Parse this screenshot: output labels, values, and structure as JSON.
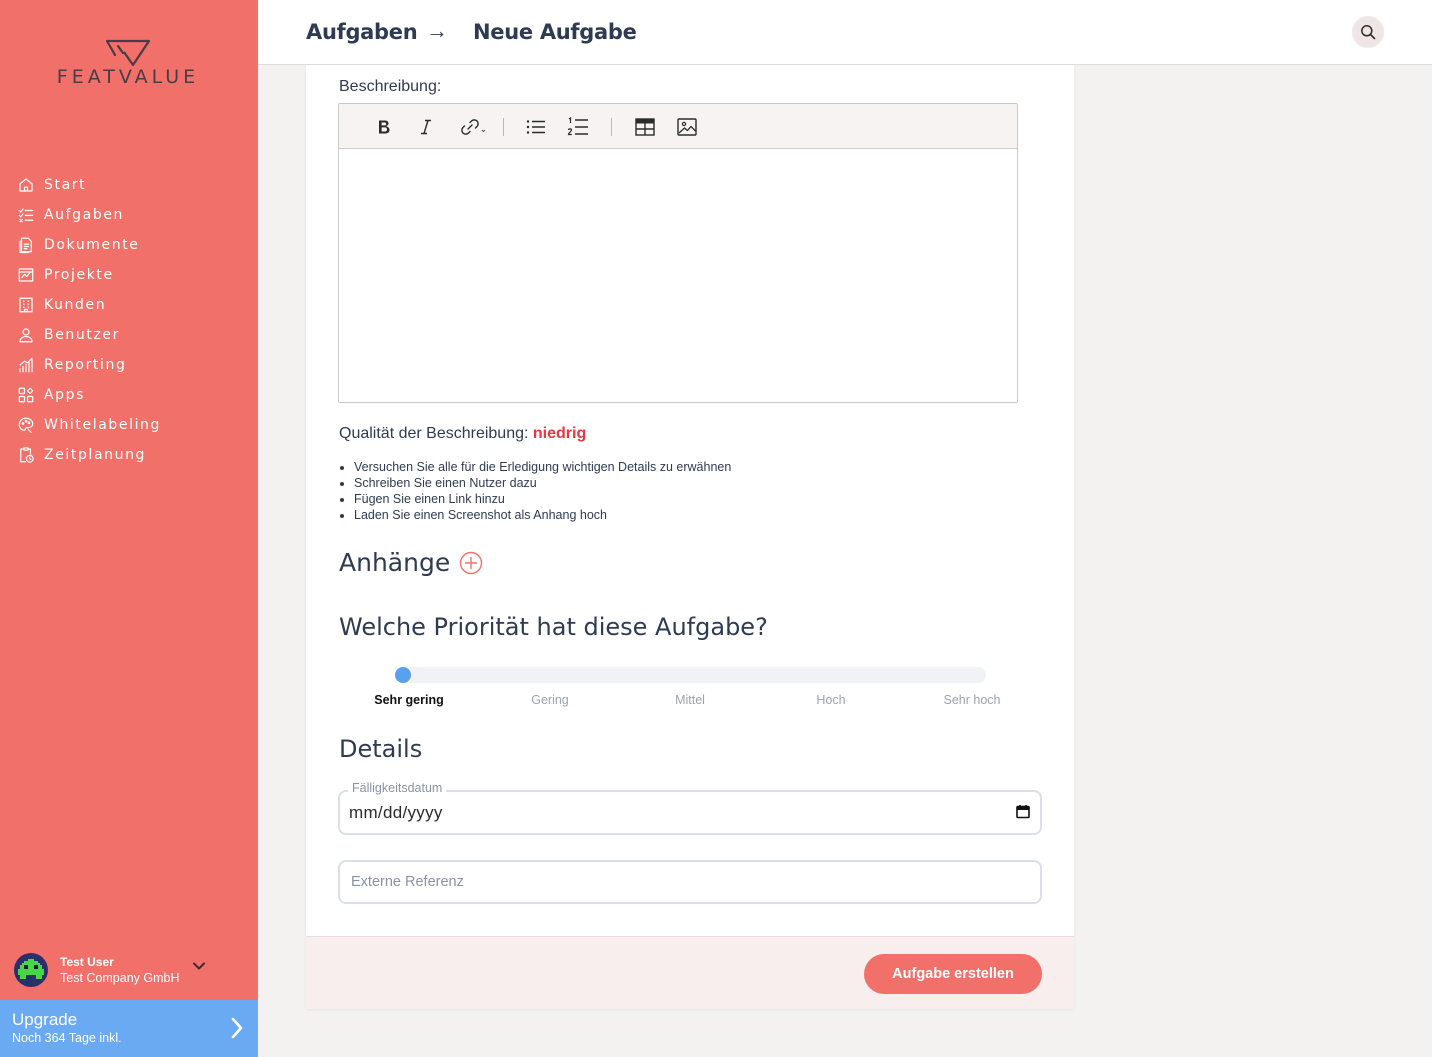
{
  "brand": {
    "name": "FEATVALUE",
    "color": "#f2706a"
  },
  "sidebar": {
    "items": [
      {
        "label": "Start",
        "icon": "home-icon"
      },
      {
        "label": "Aufgaben",
        "icon": "task-list-icon"
      },
      {
        "label": "Dokumente",
        "icon": "document-icon"
      },
      {
        "label": "Projekte",
        "icon": "chart-board-icon"
      },
      {
        "label": "Kunden",
        "icon": "building-icon"
      },
      {
        "label": "Benutzer",
        "icon": "user-icon"
      },
      {
        "label": "Reporting",
        "icon": "bar-chart-icon"
      },
      {
        "label": "Apps",
        "icon": "apps-icon"
      },
      {
        "label": "Whitelabeling",
        "icon": "palette-icon"
      },
      {
        "label": "Zeitplanung",
        "icon": "clipboard-clock-icon"
      }
    ],
    "user": {
      "name": "Test User",
      "company": "Test Company GmbH"
    },
    "upgrade": {
      "title": "Upgrade",
      "subtitle": "Noch 364 Tage inkl.",
      "color": "#6aaaf2"
    }
  },
  "header": {
    "breadcrumb": [
      "Aufgaben",
      "Neue Aufgabe"
    ],
    "separator": "→"
  },
  "form": {
    "description_label": "Beschreibung:",
    "toolbar": [
      "bold",
      "italic",
      "link",
      "bullet-list",
      "numbered-list",
      "table",
      "image"
    ],
    "quality_label": "Qualität der Beschreibung:",
    "quality_value": "niedrig",
    "quality_color": "#e9363f",
    "tips": [
      "Versuchen Sie alle für die Erledigung wichtigen Details zu erwähnen",
      "Schreiben Sie einen Nutzer dazu",
      "Fügen Sie einen Link hinzu",
      "Laden Sie einen Screenshot als Anhang hoch"
    ],
    "attachments_title": "Anhänge",
    "priority_title": "Welche Priorität hat diese Aufgabe?",
    "priority_options": [
      "Sehr gering",
      "Gering",
      "Mittel",
      "Hoch",
      "Sehr hoch"
    ],
    "priority_selected": 0,
    "details_title": "Details",
    "due_date_label": "Fälligkeitsdatum",
    "due_date_value": "mm/dd/yyyy",
    "external_ref_placeholder": "Externe Referenz",
    "submit_label": "Aufgabe erstellen"
  }
}
